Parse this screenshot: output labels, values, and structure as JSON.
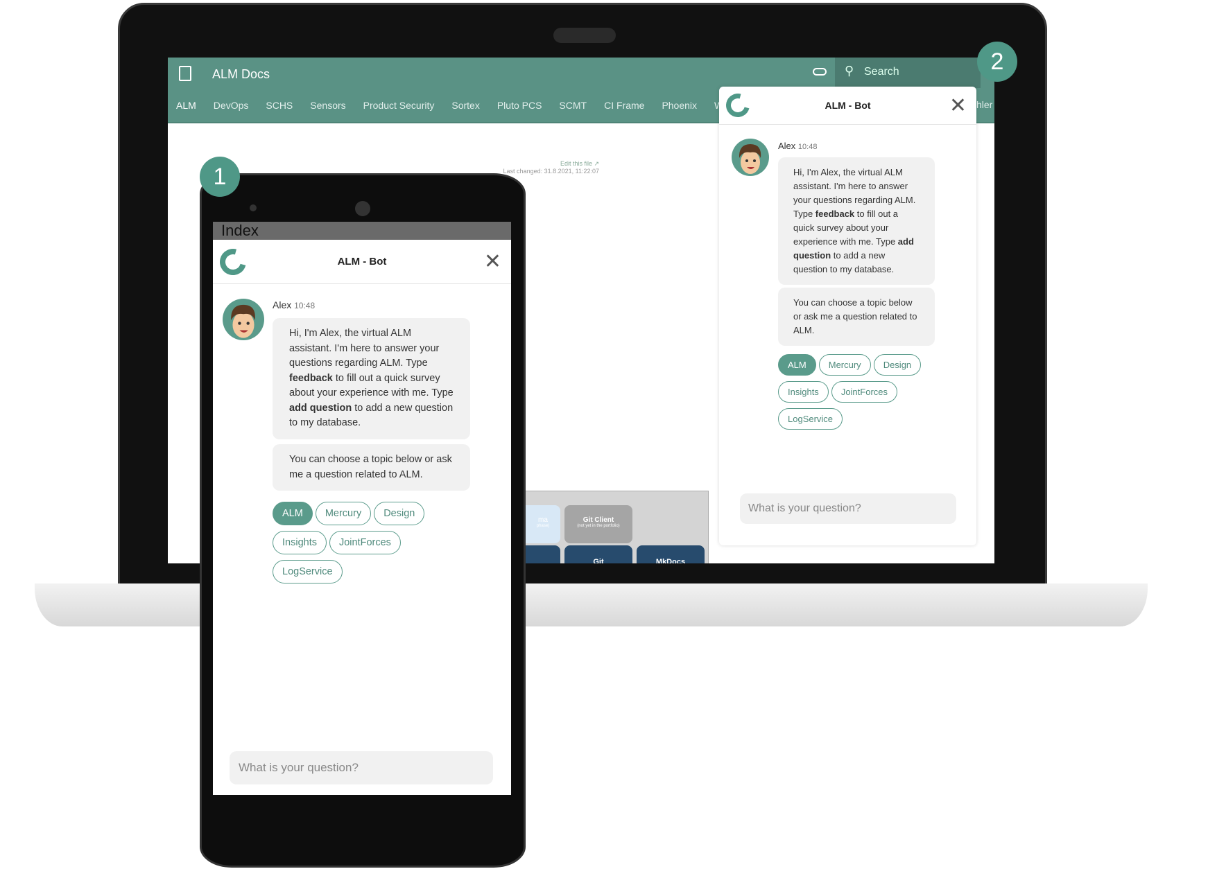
{
  "app": {
    "title": "ALM Docs",
    "search_placeholder": "Search",
    "nav": [
      "ALM",
      "DevOps",
      "SCHS",
      "Sensors",
      "Product Security",
      "Sortex",
      "Pluto PCS",
      "SCMT",
      "CI Frame",
      "Phoenix",
      "Waf"
    ],
    "nav_overflow": "hler",
    "edit_link": "Edit this file ↗",
    "last_changed": "Last changed: 31.8.2021, 11:22:07",
    "diagram": {
      "box1_title": "ma",
      "box1_sub": "phase)",
      "box2_title": "Git Client",
      "box2_sub": "(not yet in the portfolio)",
      "box3": "Git",
      "box4": "MkDocs"
    },
    "page_heading": "Index"
  },
  "badges": {
    "phone": "1",
    "desktop": "2"
  },
  "chat": {
    "title": "ALM - Bot",
    "sender": "Alex",
    "time": "10:48",
    "msg1_a": "Hi, I'm Alex, the virtual ALM assistant. I'm here to answer your questions regarding ALM. Type ",
    "msg1_b": "feedback",
    "msg1_c": " to fill out a quick survey about your experience with me. Type ",
    "msg1_d": "add question",
    "msg1_e": " to add a new question to my database.",
    "msg2": "You can choose a topic below or ask me a question related to ALM.",
    "topics": [
      "ALM",
      "Mercury",
      "Design",
      "Insights",
      "JointForces",
      "LogService"
    ],
    "selected_topic": "ALM",
    "input_placeholder": "What is your question?"
  },
  "colors": {
    "accent": "#5a9285",
    "chip": "#5a9b8b"
  }
}
